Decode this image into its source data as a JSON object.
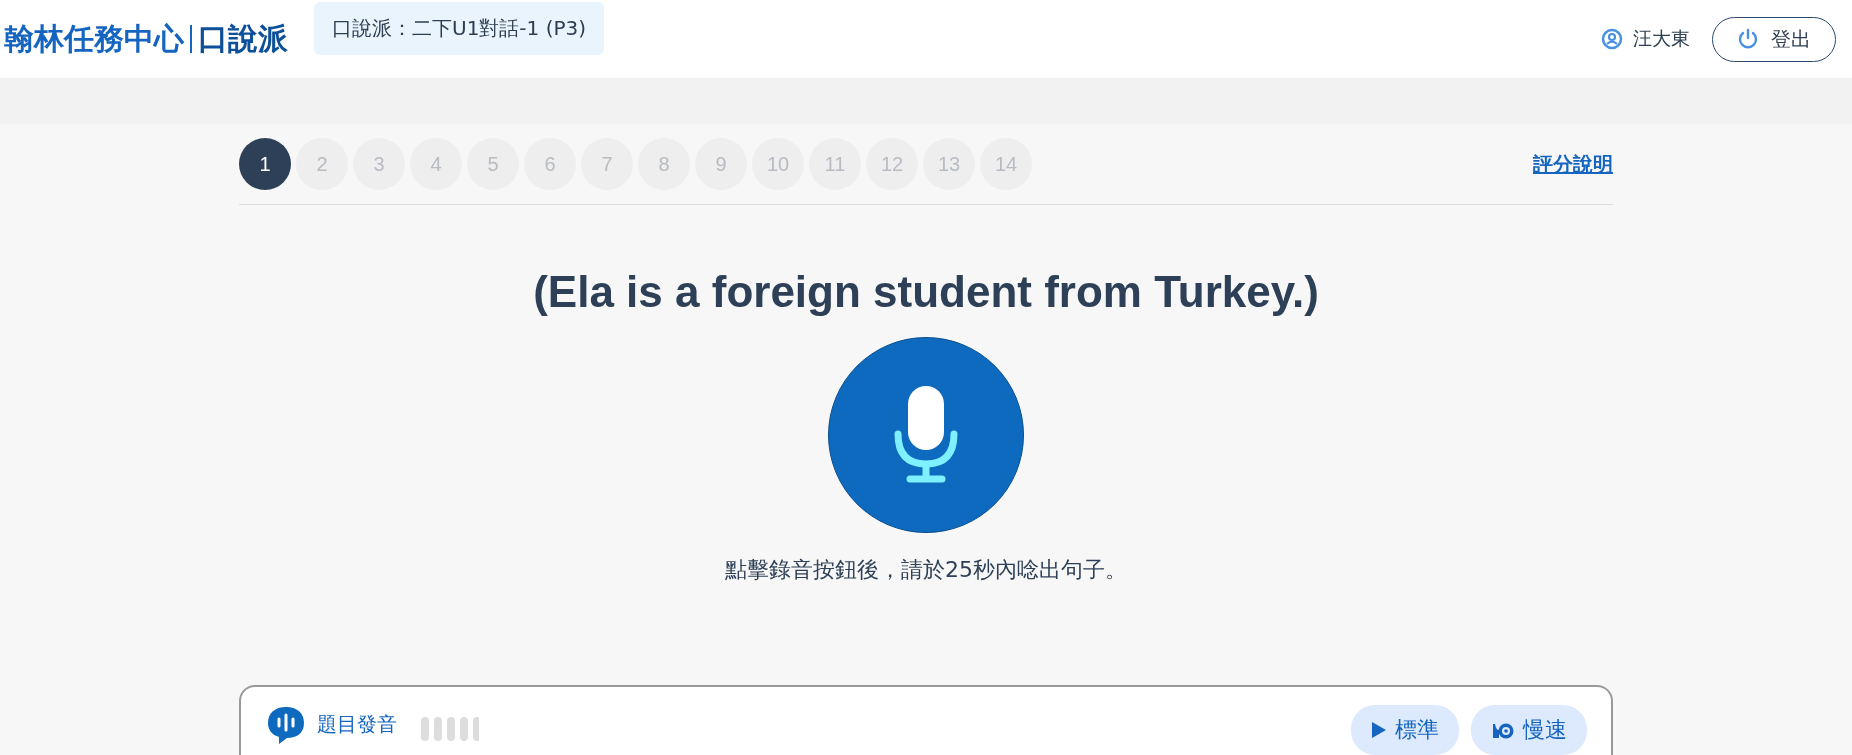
{
  "header": {
    "brand": "翰林任務中心",
    "product": "口說派",
    "lesson": "口說派：二下U1對話-1 (P3)",
    "user": "汪大東",
    "logout": "登出"
  },
  "pages": [
    {
      "label": "1",
      "selected": true
    },
    {
      "label": "2",
      "selected": false
    },
    {
      "label": "3",
      "selected": false
    },
    {
      "label": "4",
      "selected": false
    },
    {
      "label": "5",
      "selected": false
    },
    {
      "label": "6",
      "selected": false
    },
    {
      "label": "7",
      "selected": false
    },
    {
      "label": "8",
      "selected": false
    },
    {
      "label": "9",
      "selected": false
    },
    {
      "label": "10",
      "selected": false
    },
    {
      "label": "11",
      "selected": false
    },
    {
      "label": "12",
      "selected": false
    },
    {
      "label": "13",
      "selected": false
    },
    {
      "label": "14",
      "selected": false
    }
  ],
  "scoring_link": "評分說明",
  "sentence": "(Ela is a foreign student from Turkey.)",
  "instruction": "點擊錄音按鈕後，請於25秒內唸出句子。",
  "audio_panel": {
    "title": "題目發音",
    "buttons": [
      {
        "kind": "play",
        "label": "標準"
      },
      {
        "kind": "slow",
        "label": "慢速"
      }
    ]
  }
}
